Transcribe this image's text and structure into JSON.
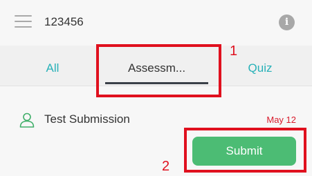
{
  "header": {
    "menu_icon": "hamburger-menu-icon",
    "title": "123456",
    "info_icon": "info-icon",
    "info_glyph": "i"
  },
  "tabs": [
    {
      "label": "All",
      "active": false
    },
    {
      "label": "Assessm...",
      "active": true
    },
    {
      "label": "Quiz",
      "active": false
    }
  ],
  "item": {
    "icon": "user-outline-icon",
    "title": "Test Submission",
    "date": "May 12",
    "button_label": "Submit"
  },
  "annotations": [
    {
      "label": "1"
    },
    {
      "label": "2"
    }
  ],
  "colors": {
    "accent": "#27b1b8",
    "button": "#4cbc74",
    "date": "#d81b2c",
    "annotation": "#e0101e"
  }
}
